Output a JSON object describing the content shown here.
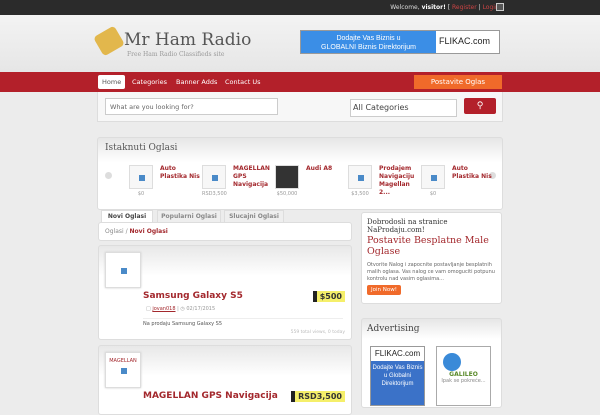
{
  "topbar": {
    "welcome": "Welcome,",
    "user": "visitor!",
    "register": "Register",
    "login": "Login"
  },
  "header": {
    "logo": "Mr Ham Radio",
    "slogan": "Free Ham Radio Classifieds site",
    "banner": {
      "line1": "Dodajte Vas Biznis u",
      "line2": "GLOBALNI Biznis Direktorijum",
      "site": "FLIKAC.com"
    }
  },
  "nav": {
    "items": [
      "Home",
      "Categories",
      "Banner Adds",
      "Contact Us"
    ],
    "post": "Postavite Oglas"
  },
  "search": {
    "placeholder": "What are you looking for?",
    "category": "All Categories"
  },
  "featured": {
    "title": "Istaknuti Oglasi",
    "items": [
      {
        "title": "Auto Plastika Nis",
        "price": "$0"
      },
      {
        "title": "MAGELLAN GPS Navigacija",
        "price": "RSD3,500"
      },
      {
        "title": "Audi A8",
        "price": "$50,000"
      },
      {
        "title": "Prodajem Navigaciju Magellan 2...",
        "price": "$3,500"
      },
      {
        "title": "Auto Plastika Nis",
        "price": "$0"
      }
    ]
  },
  "tabs": [
    "Novi Oglasi",
    "Popularni Oglasi",
    "Slucajni Oglasi"
  ],
  "breadcrumb": {
    "root": "Oglasi",
    "current": "Novi Oglasi"
  },
  "listings": [
    {
      "title": "Samsung Galaxy S5",
      "price": "$500",
      "author": "jovan018",
      "date": "02/17/2015",
      "desc": "Na prodaju Samsung Galaxy S5",
      "views": "559 total views, 0 today"
    },
    {
      "title": "MAGELLAN GPS Navigacija",
      "price": "RSD3,500",
      "thumb_label": "MAGELLAN"
    }
  ],
  "sidebar": {
    "welcome1": "Dobrodosli na stranice NaProdaju.com!",
    "welcome2": "Postavite Besplatne Male Oglase",
    "text": "Otvorite Nalog i zapocnite postavljanje besplatnih malih oglasa. Vas nalog ce vam omoguciti potpunu kontrolu nad vasim oglasima...",
    "join": "Join Now!",
    "adv_title": "Advertising",
    "ad1": {
      "site": "FLIKAC.com",
      "text": "Dodajte Vas Biznis u Globalni Direktorijum"
    },
    "ad2": {
      "brand": "GALILEO",
      "text": "Ipak se pokreće..."
    }
  }
}
